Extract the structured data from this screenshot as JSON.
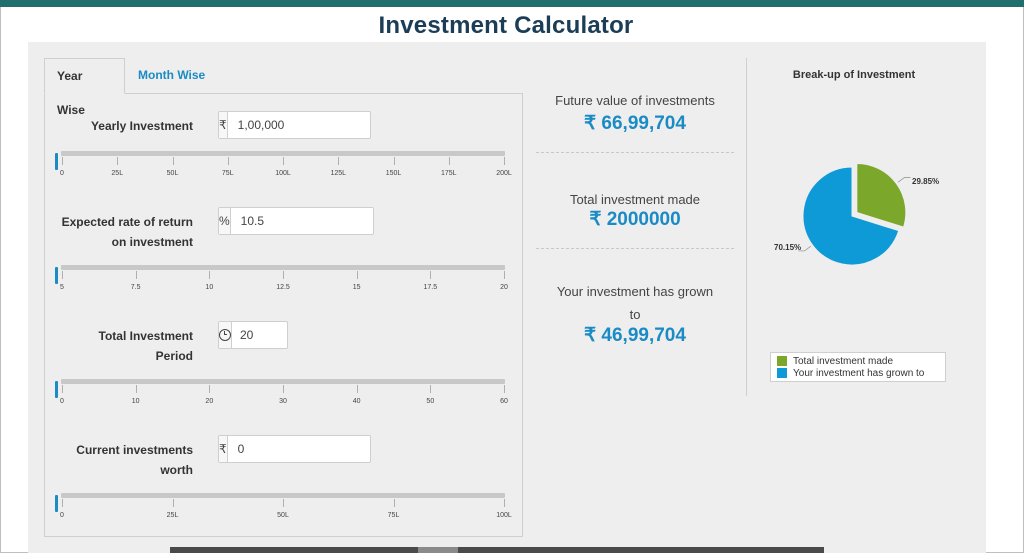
{
  "page_title": "Investment Calculator",
  "tabs": [
    {
      "label": "Year Wise",
      "active": true
    },
    {
      "label": "Month Wise",
      "active": false
    }
  ],
  "fields": {
    "yearly_investment": {
      "label_lines": [
        "Yearly Investment"
      ],
      "prefix": "₹",
      "value": "1,00,000",
      "slider_fraction": 0.0,
      "ticks": [
        "0",
        "25L",
        "50L",
        "75L",
        "100L",
        "125L",
        "150L",
        "175L",
        "200L"
      ]
    },
    "rate_of_return": {
      "label_lines": [
        "Expected rate of return",
        "on investment"
      ],
      "prefix": "%",
      "value": "10.5",
      "slider_fraction": 0.0,
      "ticks": [
        "5",
        "7.5",
        "10",
        "12.5",
        "15",
        "17.5",
        "20"
      ]
    },
    "investment_period": {
      "label_lines": [
        "Total Investment",
        "Period"
      ],
      "prefix_icon": "clock-icon",
      "value": "20",
      "slider_fraction": 0.0,
      "ticks": [
        "0",
        "10",
        "20",
        "30",
        "40",
        "50",
        "60"
      ]
    },
    "current_investments": {
      "label_lines": [
        "Current investments",
        "worth"
      ],
      "prefix": "₹",
      "value": "0",
      "slider_fraction": 0.0,
      "ticks": [
        "0",
        "25L",
        "50L",
        "75L",
        "100L"
      ]
    }
  },
  "results": {
    "future_value": {
      "label_lines": [
        "Future value of investments"
      ],
      "value": "₹ 66,99,704"
    },
    "total_investment": {
      "label_lines": [
        "Total investment made"
      ],
      "value": "₹ 2000000"
    },
    "grown": {
      "label_lines": [
        "Your investment has grown",
        "to"
      ],
      "value": "₹ 46,99,704"
    }
  },
  "chart_data": {
    "type": "pie",
    "title": "Break-up of Investment",
    "slices": [
      {
        "name": "Total investment made",
        "value": 29.85,
        "label": "29.85%",
        "color": "#7ba82b"
      },
      {
        "name": "Your investment has grown to",
        "value": 70.15,
        "label": "70.15%",
        "color": "#0e9ad7"
      }
    ],
    "legend_placement": "bottom"
  },
  "colors": {
    "accent": "#1a8bc4",
    "title": "#1b3d56",
    "top_stripe": "#1f6f6f",
    "panel": "#eeeeee"
  }
}
